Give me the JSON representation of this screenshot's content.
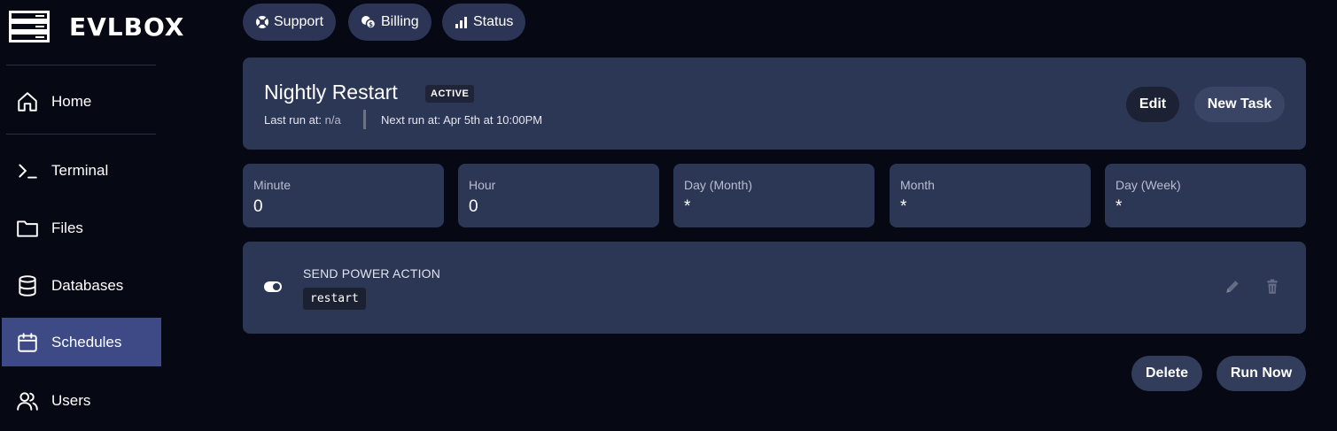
{
  "brand": {
    "name": "EVLBOX"
  },
  "sidebar": {
    "items": [
      {
        "label": "Home",
        "icon": "home-icon"
      },
      {
        "label": "Terminal",
        "icon": "terminal-icon"
      },
      {
        "label": "Files",
        "icon": "folder-icon"
      },
      {
        "label": "Databases",
        "icon": "database-icon"
      },
      {
        "label": "Schedules",
        "icon": "calendar-icon",
        "active": true
      },
      {
        "label": "Users",
        "icon": "users-icon"
      }
    ]
  },
  "top_links": [
    {
      "label": "Support",
      "icon": "lifebuoy-icon"
    },
    {
      "label": "Billing",
      "icon": "coins-icon"
    },
    {
      "label": "Status",
      "icon": "bar-chart-icon"
    }
  ],
  "schedule": {
    "name": "Nightly Restart",
    "status": "ACTIVE",
    "last_run_label": "Last run at:",
    "last_run_value": "n/a",
    "next_run": "Next run at: Apr 5th at 10:00PM",
    "edit_label": "Edit",
    "new_task_label": "New Task"
  },
  "cron": [
    {
      "label": "Minute",
      "value": "0"
    },
    {
      "label": "Hour",
      "value": "0"
    },
    {
      "label": "Day (Month)",
      "value": "*"
    },
    {
      "label": "Month",
      "value": "*"
    },
    {
      "label": "Day (Week)",
      "value": "*"
    }
  ],
  "task": {
    "title": "SEND POWER ACTION",
    "payload": "restart",
    "enabled": true
  },
  "actions": {
    "delete_label": "Delete",
    "run_now_label": "Run Now"
  },
  "colors": {
    "background": "#060814",
    "card": "#2c3655",
    "active_nav": "#3d4a86"
  }
}
